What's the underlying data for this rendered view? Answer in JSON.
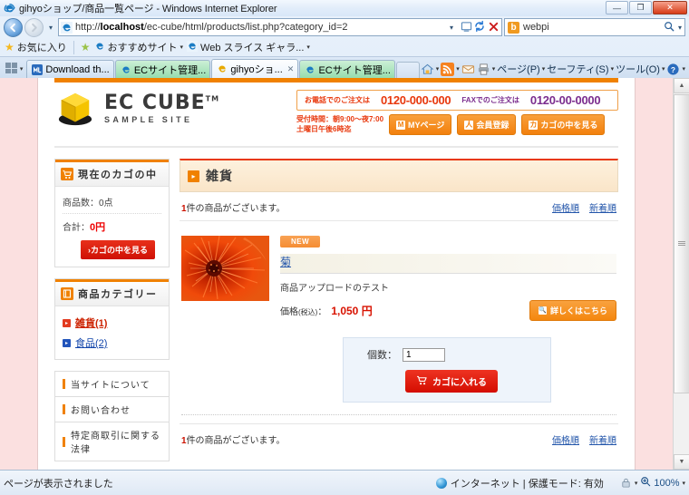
{
  "window": {
    "title": "gihyoショップ/商品一覧ページ - Windows Internet Explorer",
    "minimize_label": "—",
    "maximize_label": "❐",
    "close_label": "✕"
  },
  "browser": {
    "back_label": "◀",
    "forward_label": "▶",
    "recent_pages_label": "▾",
    "url": "http://localhost/ec-cube/html/products/list.php?category_id=2",
    "url_host": "localhost",
    "url_rest": "/ec-cube/html/products/list.php?category_id=2",
    "url_scheme": "http://",
    "url_dropdown": "▾",
    "compat_icon": "compatibility-view-icon",
    "refresh_label": "↻",
    "stop_label": "✕",
    "search_engine": "b",
    "search_value": "webpi",
    "search_icon": "🔍",
    "search_dropdown": "▾"
  },
  "favorites_bar": {
    "favorites_label": "お気に入り",
    "add_label": "",
    "items": [
      {
        "label": "おすすめサイト",
        "caret": "▾"
      },
      {
        "label": "Web スライス ギャラ...",
        "caret": "▾"
      }
    ]
  },
  "tabs": {
    "quick_tabs_label": "",
    "tab_list_caret": "▾",
    "items": [
      {
        "label": "Download th...",
        "state": "blue",
        "close": ""
      },
      {
        "label": "ECサイト管理...",
        "state": "green",
        "close": ""
      },
      {
        "label": "gihyoショ...",
        "state": "active",
        "close": "✕"
      },
      {
        "label": "ECサイト管理...",
        "state": "green",
        "close": ""
      }
    ]
  },
  "command_bar": {
    "home_label": "",
    "home_caret": "▾",
    "feeds_label": "",
    "feeds_caret": "▾",
    "mail_label": "",
    "print_label": "",
    "print_caret": "▾",
    "page_menu": "ページ(P)",
    "page_caret": "▾",
    "safety_menu": "セーフティ(S)",
    "safety_caret": "▾",
    "tools_menu": "ツール(O)",
    "tools_caret": "▾",
    "help_caret": "▾"
  },
  "site": {
    "logo_line1": "EC CUBE",
    "logo_tm": "TM",
    "logo_line2": "SAMPLE SITE",
    "phone_label": "お電話でのご注文は",
    "phone_number": "0120-000-000",
    "fax_label": "FAXでのご注文は",
    "fax_number": "0120-00-0000",
    "hours_line1": "受付時間：朝9:00～夜7:00",
    "hours_line2": "土曜日午後6時迄",
    "buttons": [
      {
        "label": "MYページ",
        "icon": "M"
      },
      {
        "label": "会員登録",
        "icon": "人"
      },
      {
        "label": "カゴの中を見る",
        "icon": "カ"
      }
    ]
  },
  "sidebar": {
    "cart": {
      "title": "現在のカゴの中",
      "icon": "cart-icon",
      "item_count_label": "商品数：0点",
      "total_label": "合計：",
      "total_value": "0円",
      "view_cart_button": "›カゴの中を見る"
    },
    "category": {
      "title": "商品カテゴリー",
      "icon": "category-icon",
      "items": [
        {
          "label": "雑貨(1)",
          "current": true
        },
        {
          "label": "食品(2)",
          "current": false
        }
      ]
    },
    "links": [
      {
        "label": "当サイトについて"
      },
      {
        "label": "お問い合わせ"
      },
      {
        "label": "特定商取引に関する法律"
      }
    ]
  },
  "main": {
    "category_title": "雑貨",
    "count_text_pre": "1",
    "count_text_post": "件の商品がございます。",
    "sort_links": [
      {
        "label": "価格順"
      },
      {
        "label": "新着順"
      }
    ],
    "product": {
      "badge": "NEW",
      "name": "菊",
      "description": "商品アップロードのテスト",
      "price_label": "価格",
      "price_tax_note": "(税込)",
      "price_colon": "：",
      "price_value": "1,050 円",
      "detail_button": "詳しくはこちら",
      "detail_icon": "search-icon",
      "image_alt": "chrysanthemum-photo"
    },
    "cart_form": {
      "qty_label": "個数：",
      "qty_value": "1",
      "add_button": "カゴに入れる",
      "add_icon": "cart-icon"
    },
    "bottom_count_pre": "1",
    "bottom_count_post": "件の商品がございます。",
    "bottom_sort_links": [
      {
        "label": "価格順"
      },
      {
        "label": "新着順"
      }
    ]
  },
  "scrollbar": {
    "up_arrow": "▲",
    "down_arrow": "▼"
  },
  "status_bar": {
    "message": "ページが表示されました",
    "zone": "インターネット | 保護モード: 有効",
    "zoom": "100%",
    "zoom_caret": "▾",
    "privacy_caret": "▾"
  },
  "colors": {
    "brand_orange": "#f08100",
    "accent_red": "#d81200",
    "link_blue": "#2255aa",
    "page_bg": "#fbe0e0"
  }
}
